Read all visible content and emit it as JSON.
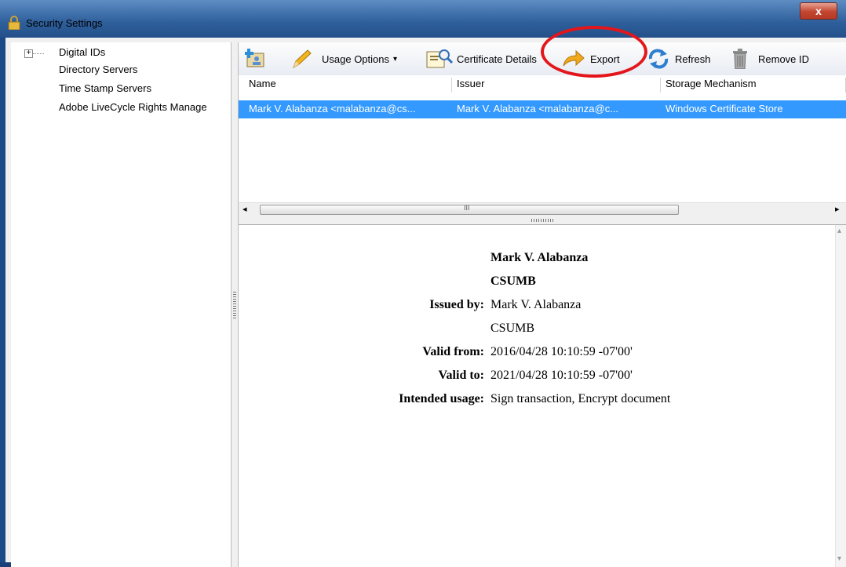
{
  "window": {
    "title": "Security Settings",
    "close_symbol": "x",
    "accent_color": "#3399ff",
    "annotation_color": "#e3161b"
  },
  "tree": {
    "expander": "+",
    "items": [
      {
        "label": "Digital IDs"
      },
      {
        "label": "Directory Servers"
      },
      {
        "label": "Time Stamp Servers"
      },
      {
        "label": "Adobe LiveCycle Rights Manage"
      }
    ]
  },
  "toolbar": {
    "add_id_icon": "add-id-icon",
    "usage_options": "Usage Options",
    "usage_options_arrow": "▾",
    "certificate_details": "Certificate Details",
    "export": "Export",
    "refresh": "Refresh",
    "remove_id": "Remove ID"
  },
  "table": {
    "columns": [
      "Name",
      "Issuer",
      "Storage Mechanism"
    ],
    "rows": [
      {
        "name": "Mark V. Alabanza <malabanza@cs...",
        "issuer": "Mark V. Alabanza <malabanza@c...",
        "storage": "Windows Certificate Store",
        "selected": true
      }
    ]
  },
  "scrollbar": {
    "left_arrow": "◂",
    "right_arrow": "▸",
    "thumb_grip": "III",
    "up_arrow": "▴",
    "down_arrow": "▾"
  },
  "details": {
    "name": "Mark V. Alabanza",
    "org": "CSUMB",
    "issued_by_label": "Issued by:",
    "issued_by_name": "Mark V. Alabanza",
    "issued_by_org": "CSUMB",
    "valid_from_label": "Valid from:",
    "valid_from": "2016/04/28 10:10:59 -07'00'",
    "valid_to_label": "Valid to:",
    "valid_to": "2021/04/28 10:10:59 -07'00'",
    "usage_label": "Intended usage:",
    "usage": "Sign transaction, Encrypt document"
  }
}
